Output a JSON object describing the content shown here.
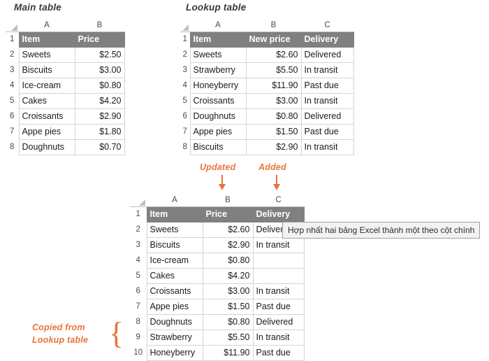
{
  "captions": {
    "main_table": "Main table",
    "lookup_table": "Lookup table"
  },
  "annotations": {
    "updated": "Updated",
    "added": "Added",
    "copied_from_line1": "Copied from",
    "copied_from_line2": "Lookup table",
    "brace_glyph": "{"
  },
  "tooltip": {
    "text": "Hợp nhất hai bảng Excel thành một theo cột chính"
  },
  "colors": {
    "header_fill": "#808080",
    "peach_fill": "#FBE0D0",
    "blue_fill": "#DAE1F0",
    "accent_orange": "#E8743B",
    "grid_line": "#D4D4D4"
  },
  "main_table": {
    "column_letters": [
      "A",
      "B"
    ],
    "row_numbers": [
      "1",
      "2",
      "3",
      "4",
      "5",
      "6",
      "7",
      "8"
    ],
    "headers": [
      "Item",
      "Price"
    ],
    "rows": [
      [
        "Sweets",
        "$2.50"
      ],
      [
        "Biscuits",
        "$3.00"
      ],
      [
        "Ice-cream",
        "$0.80"
      ],
      [
        "Cakes",
        "$4.20"
      ],
      [
        "Croissants",
        "$2.90"
      ],
      [
        "Appe pies",
        "$1.80"
      ],
      [
        "Doughnuts",
        "$0.70"
      ]
    ]
  },
  "lookup_table": {
    "column_letters": [
      "A",
      "B",
      "C"
    ],
    "row_numbers": [
      "1",
      "2",
      "3",
      "4",
      "5",
      "6",
      "7",
      "8"
    ],
    "headers": [
      "Item",
      "New price",
      "Delivery"
    ],
    "rows": [
      [
        "Sweets",
        "$2.60",
        "Delivered"
      ],
      [
        "Strawberry",
        "$5.50",
        "In transit"
      ],
      [
        "Honeyberry",
        "$11.90",
        "Past due"
      ],
      [
        "Croissants",
        "$3.00",
        "In transit"
      ],
      [
        "Doughnuts",
        "$0.80",
        "Delivered"
      ],
      [
        "Appe pies",
        "$1.50",
        "Past due"
      ],
      [
        "Biscuits",
        "$2.90",
        "In transit"
      ]
    ]
  },
  "result_table": {
    "column_letters": [
      "A",
      "B",
      "C"
    ],
    "row_numbers": [
      "1",
      "2",
      "3",
      "4",
      "5",
      "6",
      "7",
      "8",
      "9",
      "10"
    ],
    "headers": [
      "Item",
      "Price",
      "Delivery"
    ],
    "rows": [
      {
        "item": "Sweets",
        "price": "$2.60",
        "delivery": "Delivered",
        "source": "main"
      },
      {
        "item": "Biscuits",
        "price": "$2.90",
        "delivery": "In transit",
        "source": "main"
      },
      {
        "item": "Ice-cream",
        "price": "$0.80",
        "delivery": "",
        "source": "main"
      },
      {
        "item": "Cakes",
        "price": "$4.20",
        "delivery": "",
        "source": "main"
      },
      {
        "item": "Croissants",
        "price": "$3.00",
        "delivery": "In transit",
        "source": "main"
      },
      {
        "item": "Appe pies",
        "price": "$1.50",
        "delivery": "Past due",
        "source": "main"
      },
      {
        "item": "Doughnuts",
        "price": "$0.80",
        "delivery": "Delivered",
        "source": "main"
      },
      {
        "item": "Strawberry",
        "price": "$5.50",
        "delivery": "In transit",
        "source": "lookup"
      },
      {
        "item": "Honeyberry",
        "price": "$11.90",
        "delivery": "Past due",
        "source": "lookup"
      }
    ]
  }
}
